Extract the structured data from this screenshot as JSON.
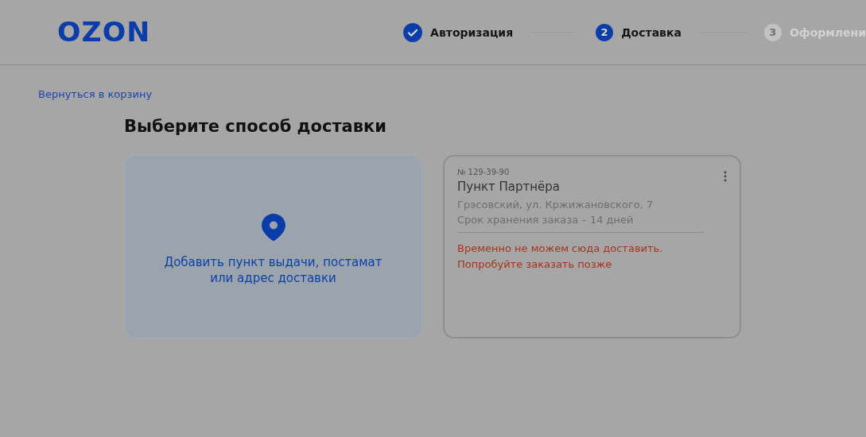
{
  "header": {
    "logo": "OZON",
    "steps": [
      {
        "kind": "done",
        "label": "Авторизация"
      },
      {
        "kind": "current",
        "marker": "2",
        "label": "Доставка"
      },
      {
        "kind": "upcoming",
        "marker": "3",
        "label": "Оформлени"
      }
    ]
  },
  "back_link": "Вернуться в корзину",
  "title": "Выберите способ доставки",
  "add_card": {
    "text": "Добавить пункт выдачи, постамат или адрес доставки"
  },
  "pickup_card": {
    "number": "№ 129-39-90",
    "name": "Пункт Партнёра",
    "address": "Грэсовский, ул. Кржижановского, 7",
    "storage": "Срок хранения заказа – 14 дней",
    "warning": [
      "Временно не можем сюда доставить.",
      "Попробуйте заказать позже"
    ]
  }
}
